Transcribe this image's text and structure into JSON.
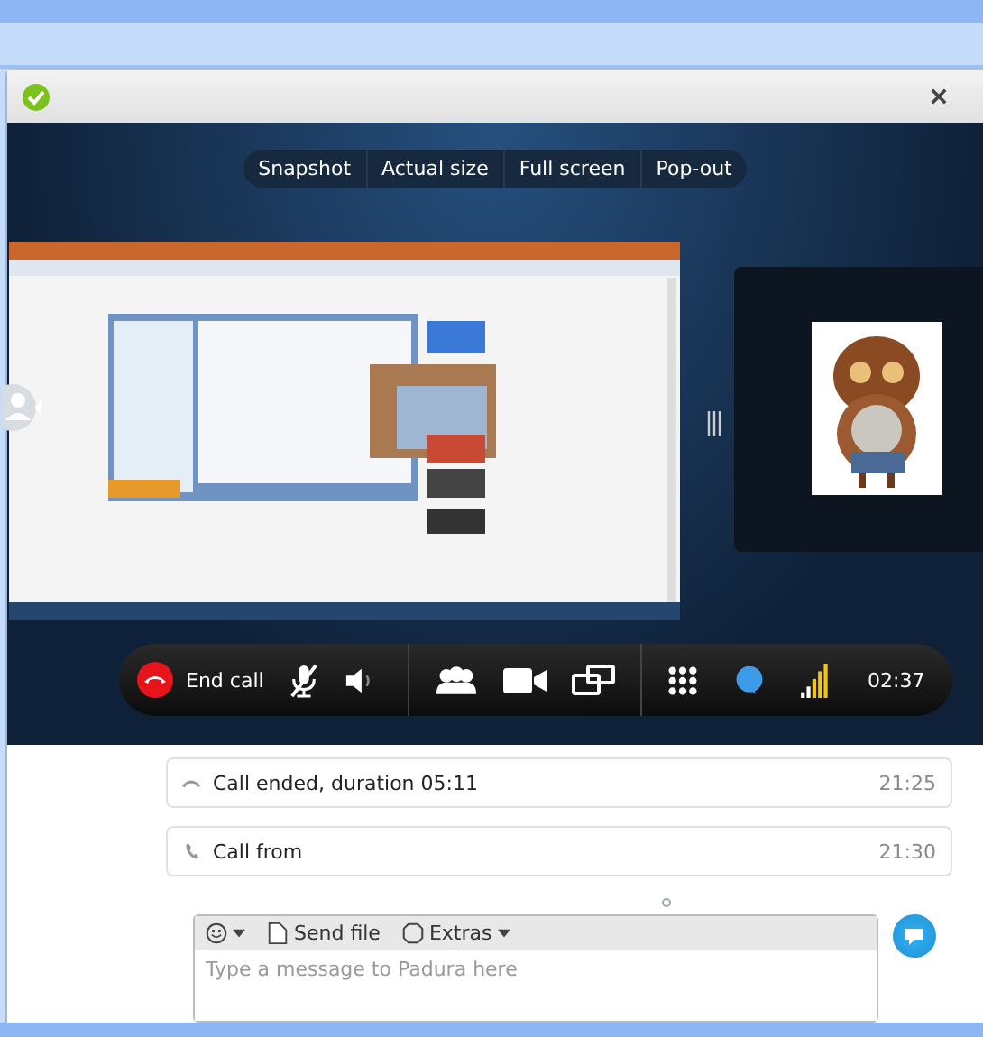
{
  "video_menu": [
    {
      "label": "Snapshot"
    },
    {
      "label": "Actual size"
    },
    {
      "label": "Full screen"
    },
    {
      "label": "Pop-out"
    }
  ],
  "call_controls": {
    "end_call": "End call",
    "muted": true,
    "timer": "02:37"
  },
  "messages": [
    {
      "kind": "ended",
      "text": "Call ended, duration 05:11",
      "time": "21:25"
    },
    {
      "kind": "incoming",
      "text": "Call from",
      "time": "21:30"
    }
  ],
  "composer": {
    "tools": [
      {
        "kind": "emoji"
      },
      {
        "kind": "file",
        "label": "Send file"
      },
      {
        "kind": "extras",
        "label": "Extras"
      }
    ],
    "placeholder": "Type a message to Padura here"
  }
}
